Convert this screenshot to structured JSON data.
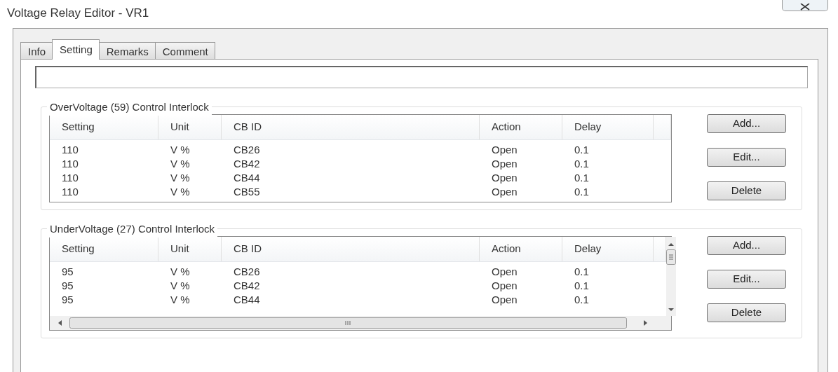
{
  "window": {
    "title": "Voltage Relay Editor - VR1"
  },
  "tabs": [
    {
      "label": "Info",
      "selected": false
    },
    {
      "label": "Setting",
      "selected": true
    },
    {
      "label": "Remarks",
      "selected": false
    },
    {
      "label": "Comment",
      "selected": false
    }
  ],
  "groups": [
    {
      "title": "OverVoltage (59) Control Interlock",
      "scrollbars": false,
      "columns": [
        "Setting",
        "Unit",
        "CB ID",
        "Action",
        "Delay"
      ],
      "rows": [
        [
          "110",
          "V %",
          "CB26",
          "Open",
          "0.1"
        ],
        [
          "110",
          "V %",
          "CB42",
          "Open",
          "0.1"
        ],
        [
          "110",
          "V %",
          "CB44",
          "Open",
          "0.1"
        ],
        [
          "110",
          "V %",
          "CB55",
          "Open",
          "0.1"
        ]
      ],
      "buttons": [
        "Add...",
        "Edit...",
        "Delete"
      ]
    },
    {
      "title": "UnderVoltage (27) Control Interlock",
      "scrollbars": true,
      "columns": [
        "Setting",
        "Unit",
        "CB ID",
        "Action",
        "Delay"
      ],
      "rows": [
        [
          "95",
          "V %",
          "CB26",
          "Open",
          "0.1"
        ],
        [
          "95",
          "V %",
          "CB42",
          "Open",
          "0.1"
        ],
        [
          "95",
          "V %",
          "CB44",
          "Open",
          "0.1"
        ]
      ],
      "buttons": [
        "Add...",
        "Edit...",
        "Delete"
      ]
    }
  ]
}
